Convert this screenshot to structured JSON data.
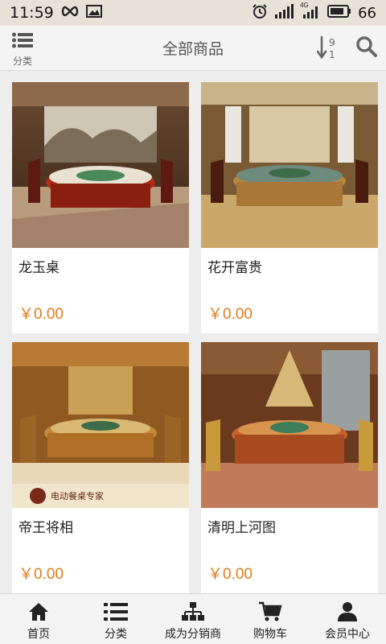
{
  "status_bar": {
    "time": "11:59",
    "battery_level": "66",
    "network_label": "4G",
    "icons": [
      "infinity-icon",
      "image-icon",
      "alarm-icon",
      "signal-icon",
      "4g-signal-icon",
      "battery-icon"
    ]
  },
  "header": {
    "menu_label": "分类",
    "title": "全部商品",
    "sort_top_digit": "9",
    "sort_bottom_digit": "1",
    "icons": [
      "list-icon",
      "sort-icon",
      "search-icon"
    ]
  },
  "products": [
    {
      "name": "龙玉桌",
      "price": "￥0.00"
    },
    {
      "name": "花开富贵",
      "price": "￥0.00"
    },
    {
      "name": "帝王将相",
      "price": "￥0.00"
    },
    {
      "name": "清明上河图",
      "price": "￥0.00"
    }
  ],
  "product_images": [
    {
      "brand_text": ""
    },
    {
      "brand_text": ""
    },
    {
      "brand_text": "电动餐桌专家"
    },
    {
      "brand_text": ""
    }
  ],
  "bottom_nav": [
    {
      "label": "首页",
      "icon": "home-icon"
    },
    {
      "label": "分类",
      "icon": "list-icon"
    },
    {
      "label": "成为分销商",
      "icon": "org-chart-icon"
    },
    {
      "label": "购物车",
      "icon": "cart-icon"
    },
    {
      "label": "会员中心",
      "icon": "user-icon"
    }
  ],
  "colors": {
    "price": "#e07b18",
    "header_bg": "#f5f4f4",
    "status_bg": "#e7e2d8",
    "page_bg": "#ededed"
  }
}
